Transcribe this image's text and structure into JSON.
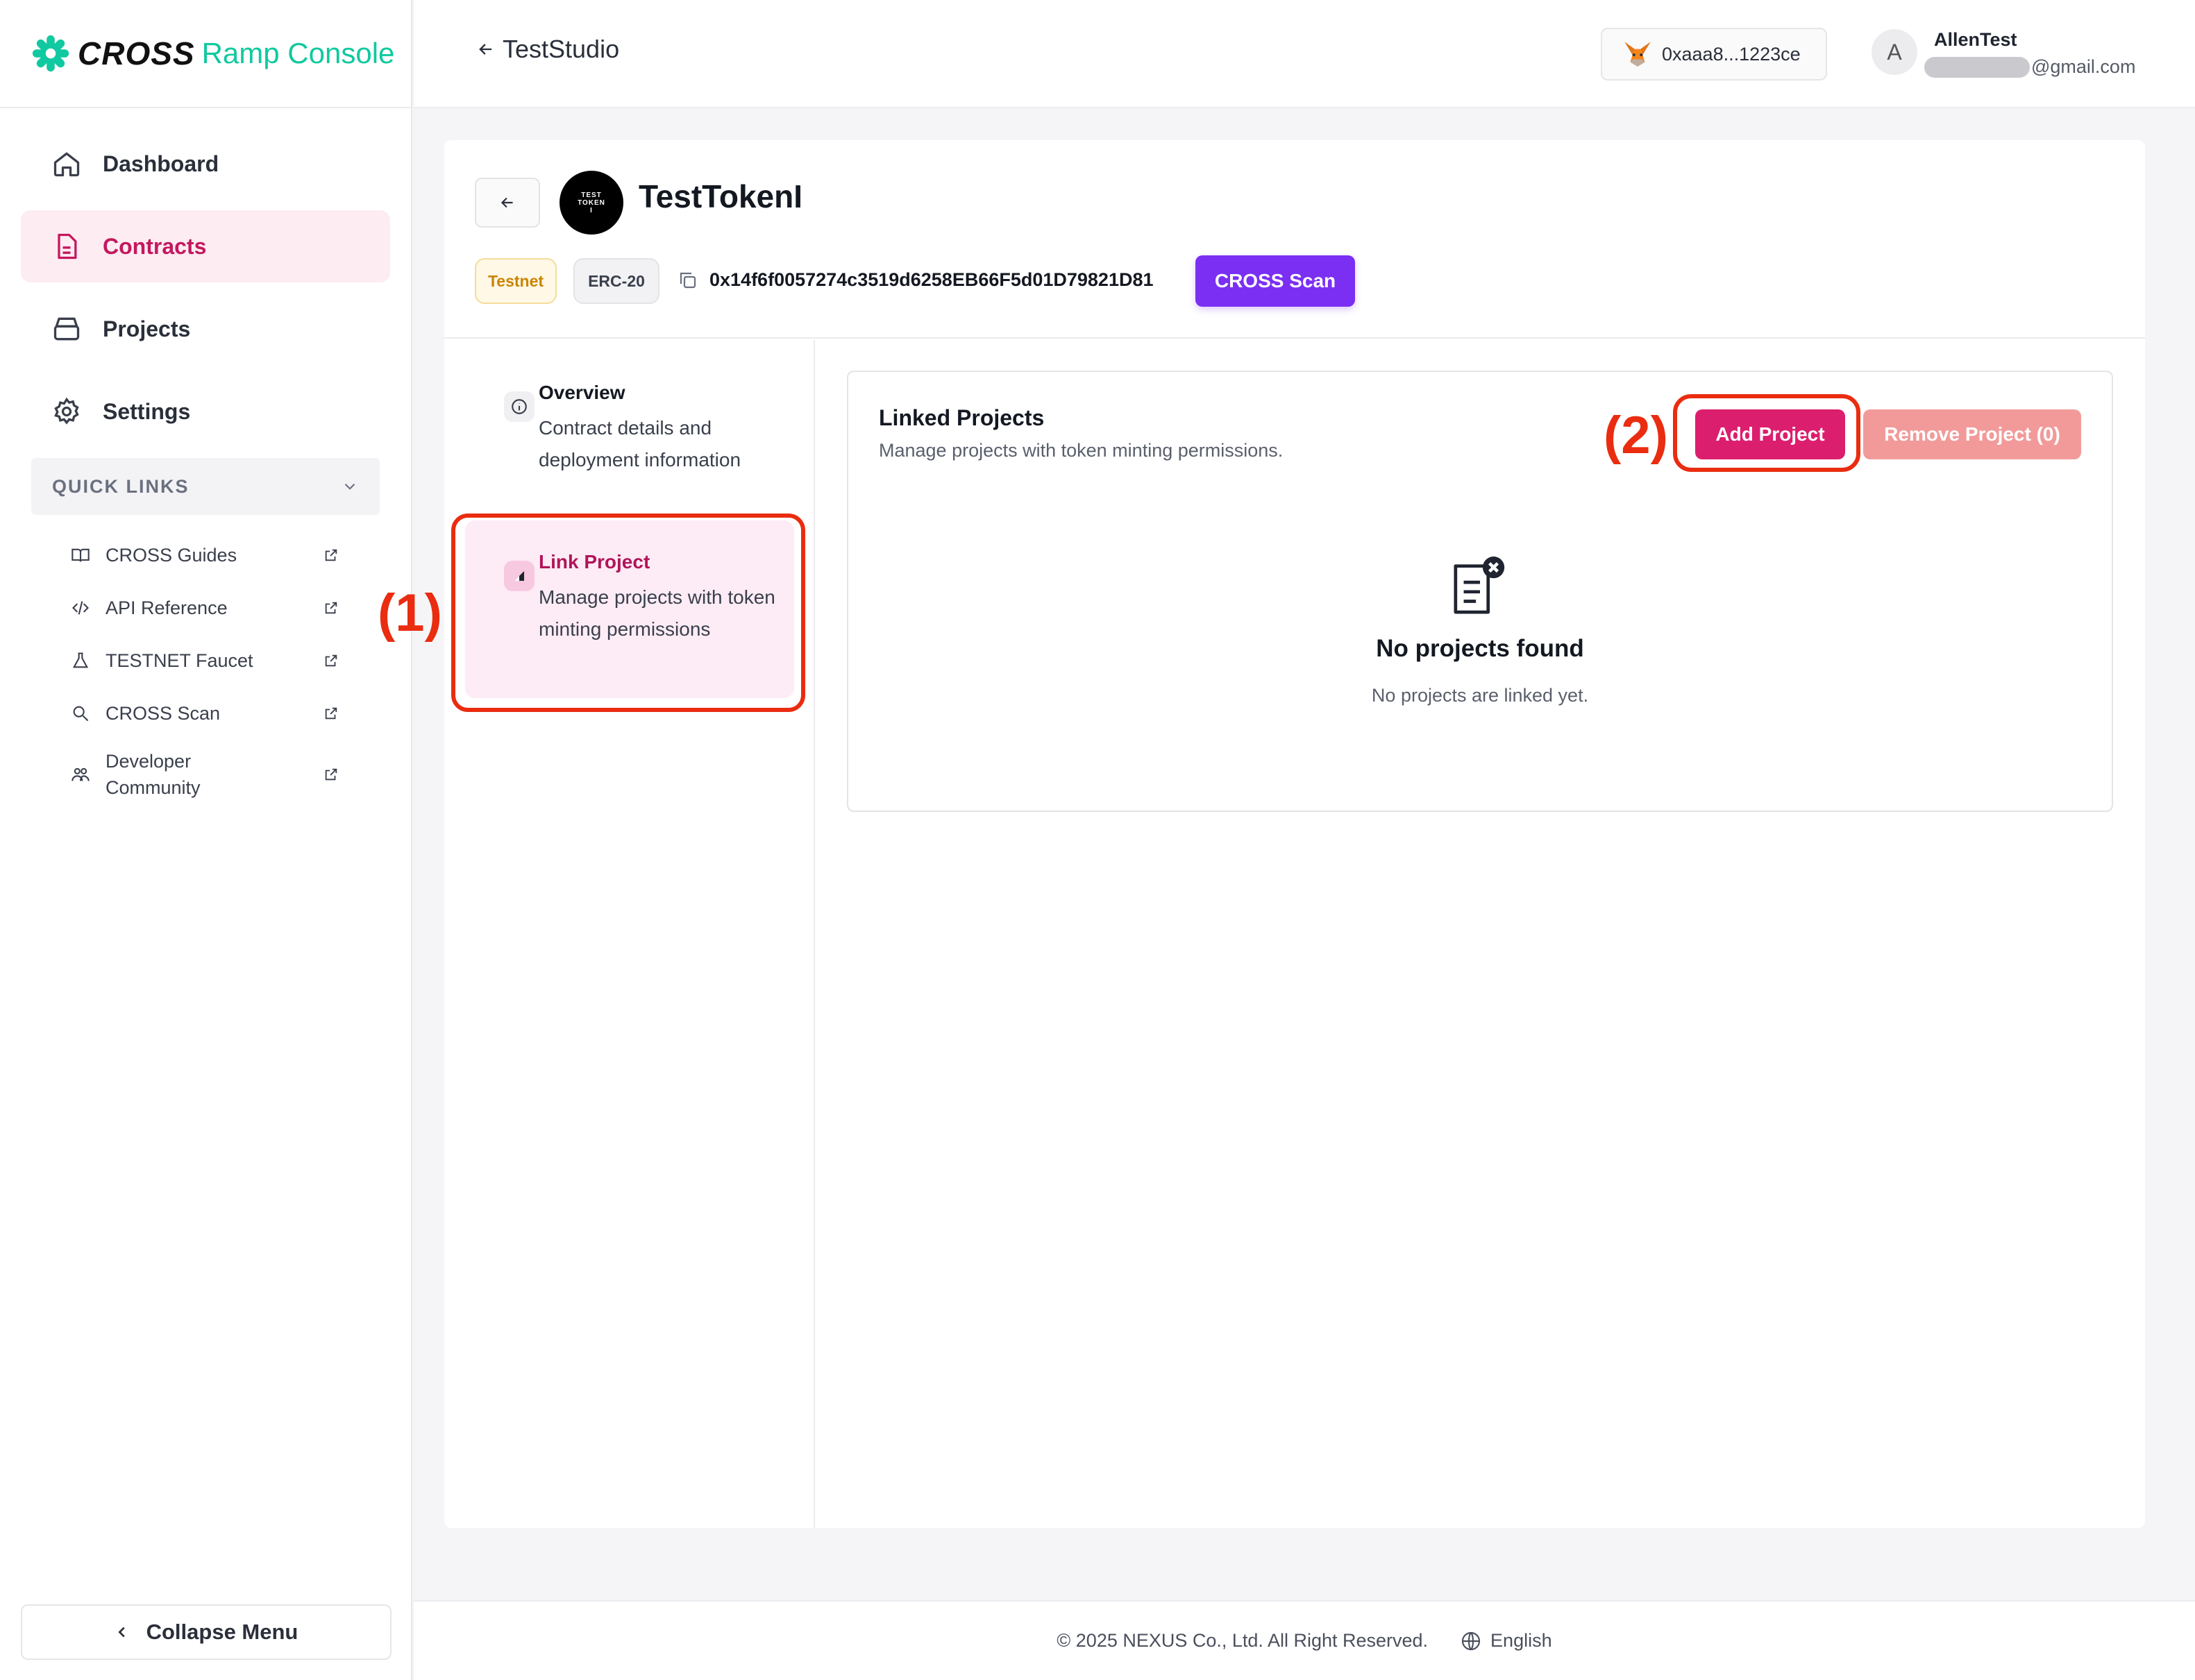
{
  "brand": {
    "name_bold": "CROSS",
    "name_rest": "Ramp Console",
    "accent": "#10c9a0"
  },
  "sidebar": {
    "nav": [
      {
        "label": "Dashboard",
        "icon": "home-icon"
      },
      {
        "label": "Contracts",
        "icon": "document-icon",
        "active": true
      },
      {
        "label": "Projects",
        "icon": "box-icon"
      },
      {
        "label": "Settings",
        "icon": "gear-icon"
      }
    ],
    "quick_links_title": "QUICK LINKS",
    "quick_links": [
      {
        "label": "CROSS Guides",
        "icon": "book-icon"
      },
      {
        "label": "API Reference",
        "icon": "code-icon"
      },
      {
        "label": "TESTNET Faucet",
        "icon": "flask-icon"
      },
      {
        "label": "CROSS Scan",
        "icon": "search-icon"
      },
      {
        "label": "Developer Community",
        "icon": "people-icon"
      }
    ],
    "collapse_label": "Collapse Menu"
  },
  "topbar": {
    "back_label": "TestStudio",
    "wallet": "0xaaa8...1223ce",
    "user": {
      "initial": "A",
      "name": "AllenTest",
      "email_suffix": "@gmail.com"
    }
  },
  "contract": {
    "name": "TestTokenI",
    "logo_text": [
      "TEST",
      "TOKEN",
      "I"
    ],
    "network_badge": "Testnet",
    "standard_badge": "ERC-20",
    "address": "0x14f6f0057274c3519d6258EB66F5d01D79821D81",
    "scan_label": "CROSS Scan"
  },
  "tabs": {
    "overview": {
      "title": "Overview",
      "desc": "Contract details and deployment information"
    },
    "link": {
      "title": "Link Project",
      "desc": "Manage projects with token minting permissions"
    }
  },
  "linked": {
    "title": "Linked Projects",
    "subtitle": "Manage projects with token minting permissions.",
    "add_label": "Add Project",
    "remove_label": "Remove Project (0)",
    "empty_title": "No projects found",
    "empty_sub": "No projects are linked yet."
  },
  "annotations": {
    "step1": "(1)",
    "step2": "(2)"
  },
  "footer": {
    "copyright": "© 2025 NEXUS Co., Ltd. All Right Reserved.",
    "language": "English"
  }
}
